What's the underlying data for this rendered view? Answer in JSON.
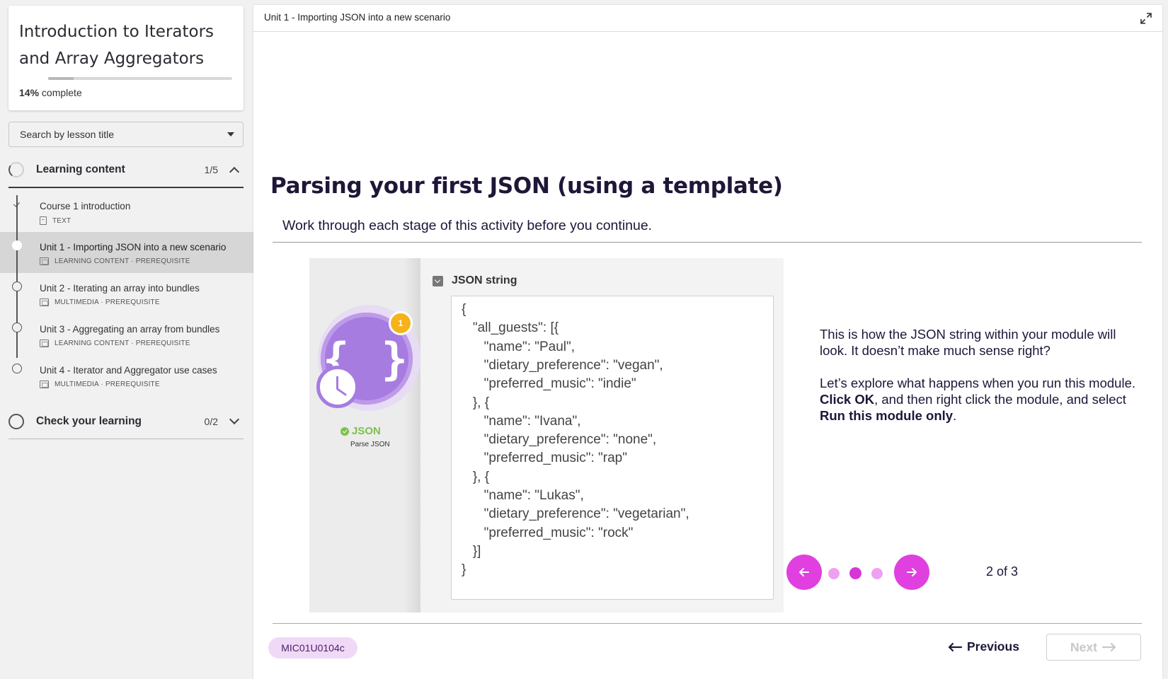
{
  "sidebar": {
    "course_title": "Introduction to Iterators and Array Aggregators",
    "progress_percent": "14%",
    "progress_suffix": "complete",
    "progress_fraction": 0.14,
    "search_placeholder": "Search by lesson title",
    "sections": [
      {
        "title": "Learning content",
        "count": "1/5",
        "expanded": true,
        "lessons": [
          {
            "title": "Course 1 introduction",
            "meta": "TEXT",
            "status": "done"
          },
          {
            "title": "Unit 1 - Importing JSON into a new scenario",
            "meta": "LEARNING CONTENT · PREREQUISITE",
            "status": "active"
          },
          {
            "title": "Unit 2 - Iterating an array into bundles",
            "meta": "MULTIMEDIA · PREREQUISITE",
            "status": "todo"
          },
          {
            "title": "Unit 3 - Aggregating an array from bundles",
            "meta": "LEARNING CONTENT · PREREQUISITE",
            "status": "todo"
          },
          {
            "title": "Unit 4 - Iterator and Aggregator use cases",
            "meta": "MULTIMEDIA · PREREQUISITE",
            "status": "todo"
          }
        ]
      },
      {
        "title": "Check your learning",
        "count": "0/2",
        "expanded": false
      }
    ]
  },
  "main": {
    "breadcrumb": "Unit 1 - Importing JSON into a new scenario",
    "slide_title": "Parsing your first JSON (using a template)",
    "slide_subtitle": "Work through each stage of this activity before you continue.",
    "illustration": {
      "module_badge": "1",
      "module_label": "JSON",
      "module_caption": "Parse JSON",
      "field_label": "JSON string",
      "json_lines": [
        "{",
        "   \"all_guests\": [{",
        "      \"name\": \"Paul\",",
        "      \"dietary_preference\": \"vegan\",",
        "      \"preferred_music\": \"indie\"",
        "   }, {",
        "      \"name\": \"Ivana\",",
        "      \"dietary_preference\": \"none\",",
        "      \"preferred_music\": \"rap\"",
        "   }, {",
        "      \"name\": \"Lukas\",",
        "      \"dietary_preference\": \"vegetarian\",",
        "      \"preferred_music\": \"rock\"",
        "   }]",
        "}"
      ]
    },
    "description": {
      "p1": "This is how the JSON string within your module will look. It doesn’t make much sense right?",
      "p2_a": "Let’s explore what happens when you run this module. ",
      "p2_b": "Click OK",
      "p2_c": ", and then right click the module, and select ",
      "p2_d": "Run this module only",
      "p2_e": "."
    },
    "carousel": {
      "pager": "2 of 3",
      "current": 2,
      "total": 3
    },
    "footer": {
      "code": "MIC01U0104c",
      "previous_label": "Previous",
      "next_label": "Next"
    }
  },
  "colors": {
    "accent": "#e040e0",
    "accent_dark": "#d636d6",
    "accent_light": "#f0a0f0",
    "heading": "#1f1638",
    "module_purple": "#a67ce0",
    "success_green": "#7cc14a"
  }
}
